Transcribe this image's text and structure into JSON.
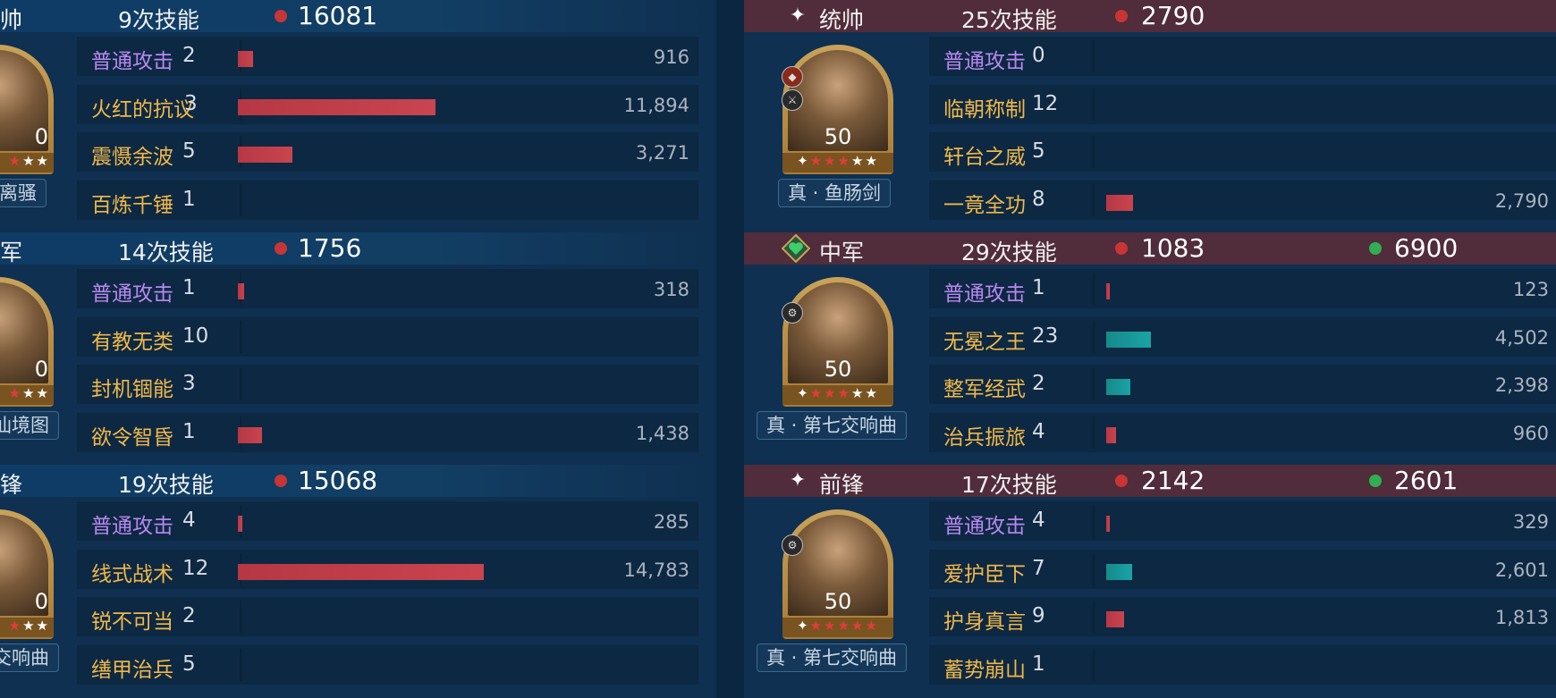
{
  "colors": {
    "normal_attack": "#b888f0",
    "skill": "#f0b84a",
    "damage_bar": "#c9444f",
    "heal_bar": "#1aa3a3",
    "damage_dot": "#c93535",
    "heal_dot": "#2fae54"
  },
  "left": {
    "sections": [
      {
        "role": "帅",
        "skill_count": "9次技能",
        "damage": "16081",
        "avatar_level": "0",
        "equipment": "离骚",
        "rows": [
          {
            "skill": "普通攻击",
            "count": "2",
            "value": "916",
            "bar_fraction": 0.05,
            "bar_type": "damage",
            "normal": true
          },
          {
            "skill": "火红的抗议",
            "count": "3",
            "value": "11,894",
            "bar_fraction": 0.65,
            "bar_type": "damage",
            "normal": false
          },
          {
            "skill": "震慑余波",
            "count": "5",
            "value": "3,271",
            "bar_fraction": 0.18,
            "bar_type": "damage",
            "normal": false
          },
          {
            "skill": "百炼千锤",
            "count": "1",
            "value": "",
            "bar_fraction": 0,
            "bar_type": "none",
            "normal": false
          }
        ]
      },
      {
        "role": "军",
        "skill_count": "14次技能",
        "damage": "1756",
        "avatar_level": "0",
        "equipment": "源仙境图",
        "rows": [
          {
            "skill": "普通攻击",
            "count": "1",
            "value": "318",
            "bar_fraction": 0.02,
            "bar_type": "damage",
            "normal": true
          },
          {
            "skill": "有教无类",
            "count": "10",
            "value": "",
            "bar_fraction": 0,
            "bar_type": "none",
            "normal": false
          },
          {
            "skill": "封机锢能",
            "count": "3",
            "value": "",
            "bar_fraction": 0,
            "bar_type": "none",
            "normal": false
          },
          {
            "skill": "欲令智昏",
            "count": "1",
            "value": "1,438",
            "bar_fraction": 0.08,
            "bar_type": "damage",
            "normal": false
          }
        ]
      },
      {
        "role": "锋",
        "skill_count": "19次技能",
        "damage": "15068",
        "avatar_level": "0",
        "equipment": "七交响曲",
        "rows": [
          {
            "skill": "普通攻击",
            "count": "4",
            "value": "285",
            "bar_fraction": 0.015,
            "bar_type": "damage",
            "normal": true
          },
          {
            "skill": "线式战术",
            "count": "12",
            "value": "14,783",
            "bar_fraction": 0.81,
            "bar_type": "damage",
            "normal": false
          },
          {
            "skill": "锐不可当",
            "count": "2",
            "value": "",
            "bar_fraction": 0,
            "bar_type": "none",
            "normal": false
          },
          {
            "skill": "缮甲治兵",
            "count": "5",
            "value": "",
            "bar_fraction": 0,
            "bar_type": "none",
            "normal": false
          }
        ]
      }
    ]
  },
  "right": {
    "sections": [
      {
        "role": "统帅",
        "role_icon": "sparkle-icon",
        "skill_count": "25次技能",
        "damage": "2790",
        "heal": "",
        "avatar_level": "50",
        "stars_red": 3,
        "stars_total": 5,
        "equipment": "真 · 鱼肠剑",
        "rows": [
          {
            "skill": "普通攻击",
            "count": "0",
            "value": "",
            "bar_fraction": 0,
            "bar_type": "none",
            "normal": true
          },
          {
            "skill": "临朝称制",
            "count": "12",
            "value": "",
            "bar_fraction": 0,
            "bar_type": "none",
            "normal": false
          },
          {
            "skill": "轩台之威",
            "count": "5",
            "value": "",
            "bar_fraction": 0,
            "bar_type": "none",
            "normal": false
          },
          {
            "skill": "一竟全功",
            "count": "8",
            "value": "2,790",
            "bar_fraction": 0.09,
            "bar_type": "damage",
            "normal": false
          }
        ]
      },
      {
        "role": "中军",
        "role_icon": "heart-diamond-icon",
        "skill_count": "29次技能",
        "damage": "1083",
        "heal": "6900",
        "avatar_level": "50",
        "stars_red": 3,
        "stars_total": 5,
        "equipment": "真 · 第七交响曲",
        "rows": [
          {
            "skill": "普通攻击",
            "count": "1",
            "value": "123",
            "bar_fraction": 0.005,
            "bar_type": "damage",
            "normal": true
          },
          {
            "skill": "无冕之王",
            "count": "23",
            "value": "4,502",
            "bar_fraction": 0.15,
            "bar_type": "heal",
            "normal": false
          },
          {
            "skill": "整军经武",
            "count": "2",
            "value": "2,398",
            "bar_fraction": 0.08,
            "bar_type": "heal",
            "normal": false
          },
          {
            "skill": "治兵振旅",
            "count": "4",
            "value": "960",
            "bar_fraction": 0.032,
            "bar_type": "damage",
            "normal": false
          }
        ]
      },
      {
        "role": "前锋",
        "role_icon": "sparkle-icon",
        "skill_count": "17次技能",
        "damage": "2142",
        "heal": "2601",
        "avatar_level": "50",
        "stars_red": 5,
        "stars_total": 5,
        "equipment": "真 · 第七交响曲",
        "rows": [
          {
            "skill": "普通攻击",
            "count": "4",
            "value": "329",
            "bar_fraction": 0.012,
            "bar_type": "damage",
            "normal": true
          },
          {
            "skill": "爱护臣下",
            "count": "7",
            "value": "2,601",
            "bar_fraction": 0.087,
            "bar_type": "heal",
            "normal": false
          },
          {
            "skill": "护身真言",
            "count": "9",
            "value": "1,813",
            "bar_fraction": 0.06,
            "bar_type": "damage",
            "normal": false
          },
          {
            "skill": "蓄势崩山",
            "count": "1",
            "value": "",
            "bar_fraction": 0,
            "bar_type": "none",
            "normal": false
          }
        ]
      }
    ]
  }
}
